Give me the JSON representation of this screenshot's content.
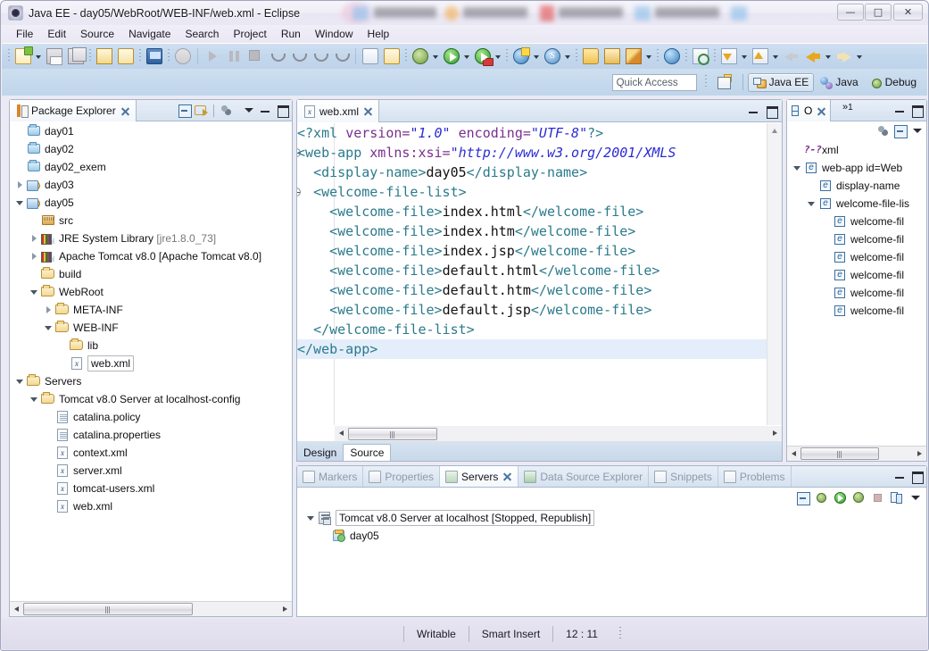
{
  "window": {
    "title": "Java EE - day05/WebRoot/WEB-INF/web.xml - Eclipse",
    "app_icon": "eclipse-icon",
    "minimize": "—",
    "maximize": "□",
    "close": "✕"
  },
  "menubar": {
    "items": [
      "File",
      "Edit",
      "Source",
      "Navigate",
      "Search",
      "Project",
      "Run",
      "Window",
      "Help"
    ]
  },
  "toolbar": {
    "groups": [
      {
        "items": [
          {
            "name": "new-wizard-button",
            "icon": "new-document-icon",
            "dropdown": true
          },
          {
            "name": "save-button",
            "icon": "save-icon"
          },
          {
            "name": "save-all-button",
            "icon": "save-all-icon"
          }
        ]
      },
      {
        "items": [
          {
            "name": "print-button",
            "icon": "print-icon"
          },
          {
            "name": "validate-button",
            "icon": "validate-icon"
          }
        ]
      },
      {
        "items": [
          {
            "name": "open-console-button",
            "icon": "monitor-icon"
          }
        ]
      },
      {
        "items": [
          {
            "name": "skip-breakpoints-button",
            "icon": "skip-breakpoints-icon"
          }
        ]
      },
      {
        "items": [
          {
            "name": "resume-button",
            "icon": "resume-icon"
          },
          {
            "name": "suspend-button",
            "icon": "suspend-icon"
          },
          {
            "name": "terminate-button",
            "icon": "terminate-icon"
          },
          {
            "name": "disconnect-button",
            "icon": "disconnect-icon"
          },
          {
            "name": "step-into-button",
            "icon": "step-into-icon"
          },
          {
            "name": "step-over-button",
            "icon": "step-over-icon"
          },
          {
            "name": "step-return-button",
            "icon": "step-return-icon"
          }
        ]
      },
      {
        "items": [
          {
            "name": "open-task-button",
            "icon": "task-icon"
          },
          {
            "name": "new-task-button",
            "icon": "new-task-icon"
          }
        ]
      },
      {
        "items": [
          {
            "name": "debug-button",
            "icon": "debug-bug-icon",
            "dropdown": true
          },
          {
            "name": "run-button",
            "icon": "run-green-icon",
            "dropdown": true
          },
          {
            "name": "run-on-server-button",
            "icon": "run-server-icon",
            "dropdown": true
          }
        ]
      },
      {
        "items": [
          {
            "name": "new-dynamic-web-project-button",
            "icon": "globe-new-icon",
            "dropdown": true
          },
          {
            "name": "new-server-button",
            "icon": "s-circle-icon",
            "dropdown": true
          }
        ]
      },
      {
        "items": [
          {
            "name": "open-type-button",
            "icon": "open-folder-icon"
          },
          {
            "name": "open-task-folder-button",
            "icon": "folder-icon"
          },
          {
            "name": "annotation-button",
            "icon": "pencil-icon",
            "dropdown": true
          }
        ]
      },
      {
        "items": [
          {
            "name": "web-browser-button",
            "icon": "globe-icon"
          }
        ]
      },
      {
        "items": [
          {
            "name": "search-button",
            "icon": "search-file-icon"
          }
        ]
      },
      {
        "items": [
          {
            "name": "previous-annotation-button",
            "icon": "prev-annotation-icon",
            "dropdown": true
          },
          {
            "name": "next-annotation-button",
            "icon": "next-annotation-icon",
            "dropdown": true
          },
          {
            "name": "last-edit-location-button",
            "icon": "last-edit-icon"
          },
          {
            "name": "back-button",
            "icon": "back-arrow-icon",
            "dropdown": true
          },
          {
            "name": "forward-button",
            "icon": "forward-arrow-icon",
            "dropdown": true
          }
        ]
      }
    ]
  },
  "quick_access": {
    "placeholder": "Quick Access",
    "value": ""
  },
  "perspectives": {
    "open_perspective_icon": "open-perspective-icon",
    "items": [
      {
        "label": "Java EE",
        "icon": "java-ee-perspective-icon",
        "active": true
      },
      {
        "label": "Java",
        "icon": "java-perspective-icon",
        "active": false
      },
      {
        "label": "Debug",
        "icon": "debug-perspective-icon",
        "active": false
      }
    ]
  },
  "package_explorer": {
    "title": "Package Explorer",
    "tab_icon": "package-explorer-icon",
    "close_icon": "close-icon",
    "tools": [
      "collapse-all-icon",
      "link-with-editor-icon",
      "focus-on-active-task-icon",
      "view-menu-icon",
      "minimize-icon",
      "maximize-icon"
    ],
    "tree": [
      {
        "label": "day01",
        "icon": "folder-blue-icon",
        "indent": 1,
        "twisty": "none"
      },
      {
        "label": "day02",
        "icon": "folder-blue-icon",
        "indent": 1,
        "twisty": "none"
      },
      {
        "label": "day02_exem",
        "icon": "folder-blue-icon",
        "indent": 1,
        "twisty": "none"
      },
      {
        "label": "day03",
        "icon": "web-project-warning-icon",
        "indent": 1,
        "twisty": "closed"
      },
      {
        "label": "day05",
        "icon": "web-project-icon",
        "indent": 1,
        "twisty": "open"
      },
      {
        "label": "src",
        "icon": "source-folder-icon",
        "indent": 2,
        "twisty": "none"
      },
      {
        "label": "JRE System Library ",
        "suffix": "[jre1.8.0_73]",
        "icon": "library-icon",
        "indent": 2,
        "twisty": "closed"
      },
      {
        "label": "Apache Tomcat v8.0 [Apache Tomcat v8.0]",
        "icon": "library-icon",
        "indent": 2,
        "twisty": "closed"
      },
      {
        "label": "build",
        "icon": "folder-yellow-icon",
        "indent": 2,
        "twisty": "none"
      },
      {
        "label": "WebRoot",
        "icon": "folder-yellow-icon",
        "indent": 2,
        "twisty": "open"
      },
      {
        "label": "META-INF",
        "icon": "folder-yellow-icon",
        "indent": 3,
        "twisty": "closed"
      },
      {
        "label": "WEB-INF",
        "icon": "folder-yellow-icon",
        "indent": 3,
        "twisty": "open"
      },
      {
        "label": "lib",
        "icon": "folder-yellow-icon",
        "indent": 4,
        "twisty": "none"
      },
      {
        "label": "web.xml",
        "icon": "xml-file-icon",
        "indent": 4,
        "twisty": "none",
        "selected": true
      },
      {
        "label": "Servers",
        "icon": "folder-yellow-icon",
        "indent": 1,
        "twisty": "open"
      },
      {
        "label": "Tomcat v8.0 Server at localhost-config",
        "icon": "folder-yellow-icon",
        "indent": 2,
        "twisty": "open"
      },
      {
        "label": "catalina.policy",
        "icon": "text-file-icon",
        "indent": 3,
        "twisty": "none"
      },
      {
        "label": "catalina.properties",
        "icon": "text-file-icon",
        "indent": 3,
        "twisty": "none"
      },
      {
        "label": "context.xml",
        "icon": "xml-file-icon",
        "indent": 3,
        "twisty": "none"
      },
      {
        "label": "server.xml",
        "icon": "xml-file-icon",
        "indent": 3,
        "twisty": "none"
      },
      {
        "label": "tomcat-users.xml",
        "icon": "xml-file-icon",
        "indent": 3,
        "twisty": "none"
      },
      {
        "label": "web.xml",
        "icon": "xml-file-icon",
        "indent": 3,
        "twisty": "none"
      }
    ]
  },
  "editor": {
    "tab": {
      "label": "web.xml",
      "icon": "xml-file-icon",
      "close_icon": "close-icon"
    },
    "tools": [
      "minimize-icon",
      "maximize-icon"
    ],
    "page_tabs": [
      {
        "label": "Design",
        "active": false
      },
      {
        "label": "Source",
        "active": true
      }
    ],
    "current_line": 12,
    "lines": [
      {
        "n": 1,
        "fold": false,
        "tokens": [
          {
            "t": "<?xml ",
            "c": "pi"
          },
          {
            "t": "version=",
            "c": "attrn"
          },
          {
            "t": "\"1.0\"",
            "c": "attrv"
          },
          {
            "t": " ",
            "c": "txtc"
          },
          {
            "t": "encoding=",
            "c": "attrn"
          },
          {
            "t": "\"UTF-8\"",
            "c": "attrv"
          },
          {
            "t": "?>",
            "c": "pi"
          }
        ]
      },
      {
        "n": 2,
        "fold": true,
        "tokens": [
          {
            "t": "<web-app ",
            "c": "tagc"
          },
          {
            "t": "xmlns:xsi=",
            "c": "attrn"
          },
          {
            "t": "\"http://www.w3.org/2001/XMLS",
            "c": "attrv"
          }
        ]
      },
      {
        "n": 3,
        "fold": false,
        "tokens": [
          {
            "t": "  ",
            "c": "txtc"
          },
          {
            "t": "<display-name>",
            "c": "tagc"
          },
          {
            "t": "day05",
            "c": "txtc"
          },
          {
            "t": "</display-name>",
            "c": "tagc"
          }
        ]
      },
      {
        "n": 4,
        "fold": true,
        "tokens": [
          {
            "t": "  ",
            "c": "txtc"
          },
          {
            "t": "<welcome-file-list>",
            "c": "tagc"
          }
        ]
      },
      {
        "n": 5,
        "fold": false,
        "tokens": [
          {
            "t": "    ",
            "c": "txtc"
          },
          {
            "t": "<welcome-file>",
            "c": "tagc"
          },
          {
            "t": "index.html",
            "c": "txtc"
          },
          {
            "t": "</welcome-file>",
            "c": "tagc"
          }
        ]
      },
      {
        "n": 6,
        "fold": false,
        "tokens": [
          {
            "t": "    ",
            "c": "txtc"
          },
          {
            "t": "<welcome-file>",
            "c": "tagc"
          },
          {
            "t": "index.htm",
            "c": "txtc"
          },
          {
            "t": "</welcome-file>",
            "c": "tagc"
          }
        ]
      },
      {
        "n": 7,
        "fold": false,
        "tokens": [
          {
            "t": "    ",
            "c": "txtc"
          },
          {
            "t": "<welcome-file>",
            "c": "tagc"
          },
          {
            "t": "index.jsp",
            "c": "txtc"
          },
          {
            "t": "</welcome-file>",
            "c": "tagc"
          }
        ]
      },
      {
        "n": 8,
        "fold": false,
        "tokens": [
          {
            "t": "    ",
            "c": "txtc"
          },
          {
            "t": "<welcome-file>",
            "c": "tagc"
          },
          {
            "t": "default.html",
            "c": "txtc"
          },
          {
            "t": "</welcome-file>",
            "c": "tagc"
          }
        ]
      },
      {
        "n": 9,
        "fold": false,
        "tokens": [
          {
            "t": "    ",
            "c": "txtc"
          },
          {
            "t": "<welcome-file>",
            "c": "tagc"
          },
          {
            "t": "default.htm",
            "c": "txtc"
          },
          {
            "t": "</welcome-file>",
            "c": "tagc"
          }
        ]
      },
      {
        "n": 10,
        "fold": false,
        "tokens": [
          {
            "t": "    ",
            "c": "txtc"
          },
          {
            "t": "<welcome-file>",
            "c": "tagc"
          },
          {
            "t": "default.jsp",
            "c": "txtc"
          },
          {
            "t": "</welcome-file>",
            "c": "tagc"
          }
        ]
      },
      {
        "n": 11,
        "fold": false,
        "tokens": [
          {
            "t": "  ",
            "c": "txtc"
          },
          {
            "t": "</welcome-file-list>",
            "c": "tagc"
          }
        ]
      },
      {
        "n": 12,
        "fold": false,
        "tokens": [
          {
            "t": "</web-app>",
            "c": "tagc"
          }
        ]
      }
    ]
  },
  "outline": {
    "title": "O",
    "tab_icon": "outline-icon",
    "close_icon": "close-icon",
    "overflow_label": "1",
    "tools": [
      "sort-icon",
      "collapse-all-icon",
      "view-menu-icon",
      "minimize-icon",
      "maximize-icon"
    ],
    "tree": [
      {
        "label": "xml",
        "icon": "processing-instruction-icon",
        "indent": 1,
        "twisty": "none"
      },
      {
        "label": "web-app id=Web",
        "icon": "element-icon",
        "indent": 1,
        "twisty": "open"
      },
      {
        "label": "display-name",
        "icon": "element-icon",
        "indent": 2,
        "twisty": "none"
      },
      {
        "label": "welcome-file-lis",
        "icon": "element-icon",
        "indent": 2,
        "twisty": "open"
      },
      {
        "label": "welcome-fil",
        "icon": "element-icon",
        "indent": 3,
        "twisty": "none"
      },
      {
        "label": "welcome-fil",
        "icon": "element-icon",
        "indent": 3,
        "twisty": "none"
      },
      {
        "label": "welcome-fil",
        "icon": "element-icon",
        "indent": 3,
        "twisty": "none"
      },
      {
        "label": "welcome-fil",
        "icon": "element-icon",
        "indent": 3,
        "twisty": "none"
      },
      {
        "label": "welcome-fil",
        "icon": "element-icon",
        "indent": 3,
        "twisty": "none"
      },
      {
        "label": "welcome-fil",
        "icon": "element-icon",
        "indent": 3,
        "twisty": "none"
      }
    ]
  },
  "bottom_view": {
    "tabs": [
      {
        "label": "Markers",
        "icon": "markers-icon",
        "active": false
      },
      {
        "label": "Properties",
        "icon": "properties-icon",
        "active": false
      },
      {
        "label": "Servers",
        "icon": "servers-icon",
        "active": true,
        "close_icon": "close-icon"
      },
      {
        "label": "Data Source Explorer",
        "icon": "data-source-icon",
        "active": false
      },
      {
        "label": "Snippets",
        "icon": "snippets-icon",
        "active": false
      },
      {
        "label": "Problems",
        "icon": "problems-icon",
        "active": false
      }
    ],
    "tools": [
      "collapse-all-icon",
      "debug-server-icon",
      "start-server-icon",
      "profile-server-icon",
      "stop-server-icon",
      "publish-icon",
      "view-menu-icon"
    ],
    "panel_tools": [
      "minimize-icon",
      "maximize-icon"
    ],
    "tree": [
      {
        "label": "Tomcat v8.0 Server at localhost",
        "status": "[Stopped, Republish]",
        "icon": "server-icon",
        "indent": 1,
        "twisty": "open",
        "selected": true
      },
      {
        "label": "day05",
        "icon": "module-icon",
        "indent": 2,
        "twisty": "none"
      }
    ]
  },
  "statusbar": {
    "writable": "Writable",
    "insert_mode": "Smart Insert",
    "position": "12 : 11"
  }
}
